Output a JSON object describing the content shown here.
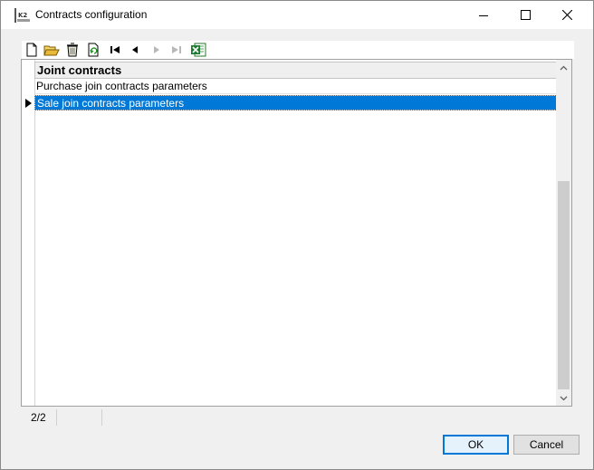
{
  "window": {
    "title": "Contracts configuration",
    "app_icon_text": "K2"
  },
  "toolbar": {
    "items": [
      {
        "name": "new-icon"
      },
      {
        "name": "open-folder-icon"
      },
      {
        "name": "delete-icon"
      },
      {
        "name": "refresh-icon"
      },
      {
        "name": "first-record-icon"
      },
      {
        "name": "previous-record-icon"
      },
      {
        "name": "next-record-icon",
        "disabled": true
      },
      {
        "name": "last-record-icon",
        "disabled": true
      },
      {
        "name": "excel-export-icon"
      }
    ]
  },
  "grid": {
    "header": "Joint contracts",
    "rows": [
      {
        "label": "Purchase join contracts parameters",
        "selected": false
      },
      {
        "label": "Sale join contracts parameters",
        "selected": true
      }
    ]
  },
  "status": {
    "record_position": "2/2",
    "cell2": ""
  },
  "buttons": {
    "ok": "OK",
    "cancel": "Cancel"
  },
  "colors": {
    "selection": "#0078d7",
    "default_button_border": "#0078d7"
  }
}
